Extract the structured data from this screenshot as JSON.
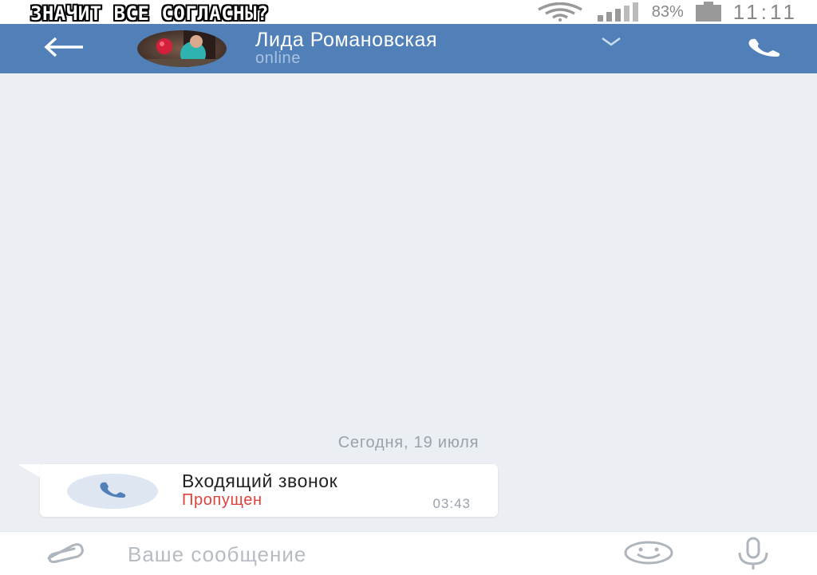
{
  "status_bar": {
    "caption": "ЗНАЧИТ ВСЕ СОГЛАСНЫ?",
    "battery_percent": "83%",
    "time": "11:11",
    "icons": [
      "wifi-icon",
      "signal-icon",
      "battery-icon"
    ]
  },
  "header": {
    "contact_name": "Лида Романовская",
    "contact_status": "online",
    "icons": [
      "back-arrow-icon",
      "chevron-down-icon",
      "phone-icon"
    ],
    "accent_color": "#5180b8"
  },
  "chat": {
    "date_separator": "Сегодня, 19 июля",
    "messages": [
      {
        "type": "call",
        "title": "Входящий звонок",
        "status": "Пропущен",
        "status_color": "#e0413b",
        "time": "03:43"
      }
    ]
  },
  "composer": {
    "placeholder": "Ваше сообщение",
    "icons": [
      "paperclip-icon",
      "smile-icon",
      "microphone-icon"
    ]
  }
}
